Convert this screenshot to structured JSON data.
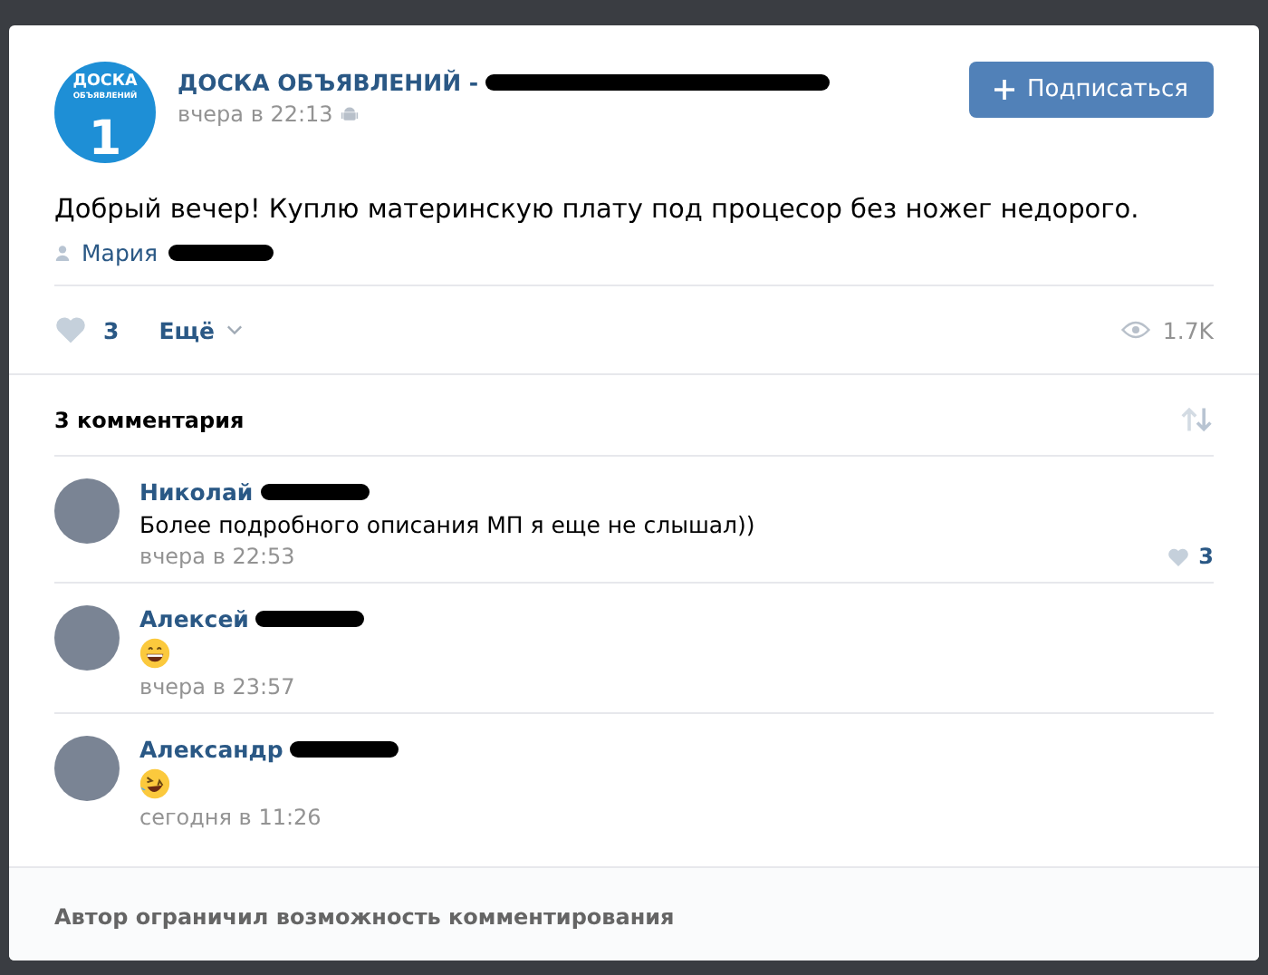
{
  "post": {
    "logo": {
      "line_1": "ДОСКА",
      "line_2": "ОБЪЯВЛЕНИЙ",
      "number": "1"
    },
    "author": "ДОСКА ОБЪЯВЛЕНИЙ -",
    "author_redacted": true,
    "time": "вчера в 22:13",
    "via_android": true,
    "subscribe_button": "Подписаться",
    "text": "Добрый вечер! Куплю материнскую плату под процесор без ножег недорого.",
    "signer": "Мария",
    "signer_redacted": true,
    "likes": "3",
    "liked": false,
    "more": "Ещё",
    "views": "1.7K"
  },
  "comments_header": {
    "title": "3 комментария"
  },
  "comments": [
    {
      "name": "Николай",
      "redacted": true,
      "kind": "text",
      "text": "Более подробного описания МП я еще не слышал))",
      "time": "вчера в 22:53",
      "likes": "3"
    },
    {
      "name": "Алексей",
      "redacted": true,
      "kind": "grin",
      "time": "вчера в 23:57"
    },
    {
      "name": "Александр",
      "redacted": true,
      "kind": "rofl",
      "time": "сегодня в 11:26"
    }
  ],
  "footer": {
    "notice": "Автор ограничил возможность комментирования"
  }
}
